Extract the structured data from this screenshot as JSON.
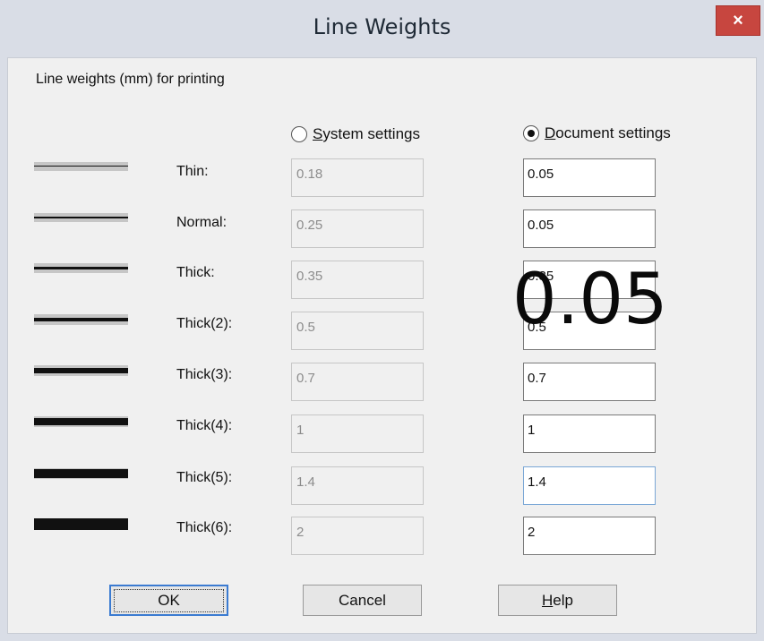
{
  "window": {
    "title": "Line Weights",
    "close_glyph": "×"
  },
  "subtitle": "Line weights (mm) for printing",
  "radios": {
    "system": {
      "accel": "S",
      "rest": "ystem settings",
      "checked": false
    },
    "document": {
      "accel": "D",
      "rest": "ocument settings",
      "checked": true
    }
  },
  "rows": [
    {
      "label": "Thin:",
      "system": "0.18",
      "document": "0.05"
    },
    {
      "label": "Normal:",
      "system": "0.25",
      "document": "0.05"
    },
    {
      "label": "Thick:",
      "system": "0.35",
      "document": "0.35"
    },
    {
      "label": "Thick(2):",
      "system": "0.5",
      "document": "0.5"
    },
    {
      "label": "Thick(3):",
      "system": "0.7",
      "document": "0.7"
    },
    {
      "label": "Thick(4):",
      "system": "1",
      "document": "1"
    },
    {
      "label": "Thick(5):",
      "system": "1.4",
      "document": "1.4"
    },
    {
      "label": "Thick(6):",
      "system": "2",
      "document": "2"
    }
  ],
  "overlay_text": "0.05",
  "buttons": {
    "ok": "OK",
    "cancel": "Cancel",
    "help_accel": "H",
    "help_rest": "elp"
  },
  "colors": {
    "close_red": "#c7463f",
    "title_bar": "#d9dde6",
    "focus_blue": "#3b7bd1"
  }
}
